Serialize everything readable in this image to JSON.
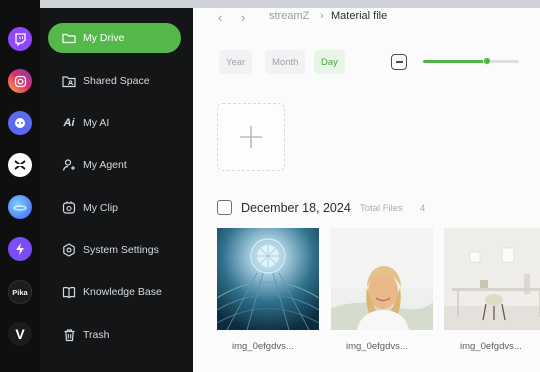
{
  "app_rail": {
    "apps": [
      {
        "name": "twitch",
        "color": "#9146ff"
      },
      {
        "name": "instagram",
        "color": "#e1306c"
      },
      {
        "name": "app-3",
        "color": "#5b6bf0"
      },
      {
        "name": "capcut",
        "color": "#ffffff"
      },
      {
        "name": "app-5",
        "color": "#3b7bf5"
      },
      {
        "name": "app-6",
        "color": "#7b4df6"
      },
      {
        "name": "pika",
        "label": "Pika",
        "color": "#e9e9e9"
      },
      {
        "name": "app-8",
        "label": "V",
        "color": "#ffffff"
      }
    ]
  },
  "sidebar": {
    "items": [
      {
        "label": "My Drive",
        "icon": "folder-icon",
        "active": true
      },
      {
        "label": "Shared Space",
        "icon": "shared-folder-icon",
        "active": false
      },
      {
        "label": "My AI",
        "icon": "ai-icon",
        "active": false
      },
      {
        "label": "My Agent",
        "icon": "agent-icon",
        "active": false
      },
      {
        "label": "My Clip",
        "icon": "clip-icon",
        "active": false
      },
      {
        "label": "System Settings",
        "icon": "settings-icon",
        "active": false
      },
      {
        "label": "Knowledge Base",
        "icon": "book-icon",
        "active": false
      },
      {
        "label": "Trash",
        "icon": "trash-icon",
        "active": false
      }
    ]
  },
  "breadcrumb": {
    "parent": "streamZ",
    "current": "Material file"
  },
  "view_filter": {
    "options": [
      "Year",
      "Month",
      "Day"
    ],
    "selected": "Day"
  },
  "zoom": {
    "level": 0.67
  },
  "date_group": {
    "date": "December 18, 2024",
    "total_label": "Total Files",
    "total_count": "4"
  },
  "files": [
    {
      "name": "img_0efgdvs...",
      "icon": "architecture-photo"
    },
    {
      "name": "img_0efgdvs...",
      "icon": "woman-portrait-photo"
    },
    {
      "name": "img_0efgdvs...",
      "icon": "desk-interior-photo"
    }
  ],
  "colors": {
    "accent": "#54b94a",
    "sidebar_bg": "#141516",
    "rail_bg": "#0f0f10",
    "content_bg": "#fbfbfb"
  }
}
